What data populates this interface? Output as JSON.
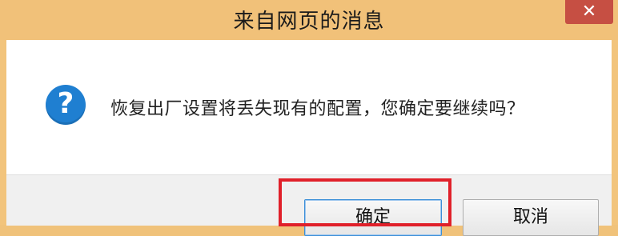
{
  "dialog": {
    "title": "来自网页的消息",
    "close_symbol": "✕",
    "icon": "question-icon",
    "icon_glyph": "?",
    "message": "恢复出厂设置将丢失现有的配置，您确定要继续吗？",
    "ok_label": "确定",
    "cancel_label": "取消"
  },
  "colors": {
    "titlebar": "#f1c179",
    "close_button": "#c64f43",
    "icon": "#1f7fd1",
    "highlight": "#e0202a"
  }
}
